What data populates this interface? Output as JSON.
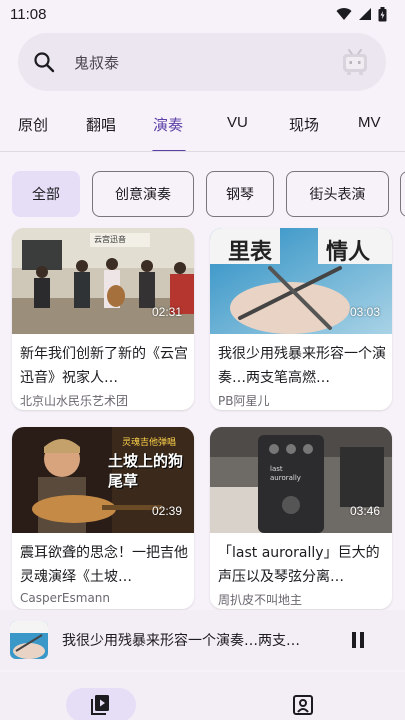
{
  "status": {
    "time": "11:08"
  },
  "search": {
    "placeholder": "鬼叔泰"
  },
  "tabs": [
    {
      "label": "原创"
    },
    {
      "label": "翻唱"
    },
    {
      "label": "演奏"
    },
    {
      "label": "VU"
    },
    {
      "label": "现场"
    },
    {
      "label": "MV"
    }
  ],
  "chips": [
    {
      "label": "全部"
    },
    {
      "label": "创意演奏"
    },
    {
      "label": "钢琴"
    },
    {
      "label": "街头表演"
    }
  ],
  "videos": [
    {
      "title": "新年我们创新了新的《云宫迅音》祝家人…",
      "author": "北京山水民乐艺术团",
      "duration": "02:31",
      "thumb_text": "云宫迅音"
    },
    {
      "title": "我很少用残暴来形容一个演奏…两支笔高燃…",
      "author": "PB阿星儿",
      "duration": "03:03",
      "thumb_text_left": "里表",
      "thumb_text_right": "情人"
    },
    {
      "title": "震耳欲聋的思念！一把吉他灵魂演绎《土坡…",
      "author": "CasperEsmann",
      "duration": "02:39",
      "thumb_text_top": "灵魂吉他弹唱",
      "thumb_text_main": "土坡上的狗尾草"
    },
    {
      "title": "「last aurorally」巨大的声压以及琴弦分离…",
      "author": "周扒皮不叫地主",
      "duration": "03:46",
      "thumb_text": "last aurorally"
    }
  ],
  "player": {
    "now_playing": "我很少用残暴来形容一个演奏…两支…"
  },
  "colors": {
    "accent": "#5b3fa6",
    "chip_selected": "#e6def6",
    "background": "#f7f2f9"
  }
}
